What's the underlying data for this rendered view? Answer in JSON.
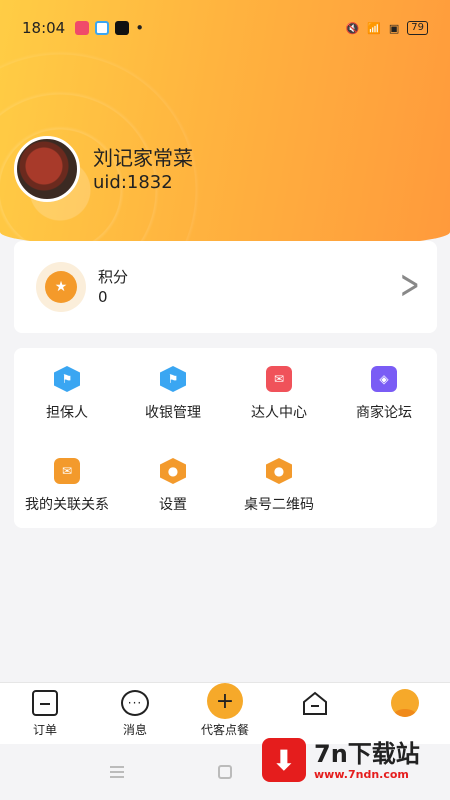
{
  "status_bar": {
    "time": "18:04",
    "battery": "79"
  },
  "profile": {
    "store_name": "刘记家常菜",
    "uid": "uid:1832"
  },
  "points": {
    "label": "积分",
    "value": "0"
  },
  "menu": [
    {
      "label": "担保人",
      "icon": "flag-icon",
      "color": "#3aa6f2"
    },
    {
      "label": "收银管理",
      "icon": "flag-icon",
      "color": "#3aa6f2"
    },
    {
      "label": "达人中心",
      "icon": "envelope-icon",
      "color": "#f0525a"
    },
    {
      "label": "商家论坛",
      "icon": "chat-icon",
      "color": "#7a5cf5"
    },
    {
      "label": "我的关联关系",
      "icon": "mail-icon",
      "color": "#f39a2c"
    },
    {
      "label": "设置",
      "icon": "gear-icon",
      "color": "#f39a2c"
    },
    {
      "label": "桌号二维码",
      "icon": "qrcode-icon",
      "color": "#f39a2c"
    }
  ],
  "bottom_nav": [
    {
      "label": "订单"
    },
    {
      "label": "消息"
    },
    {
      "label": "代客点餐"
    },
    {
      "label": ""
    },
    {
      "label": ""
    }
  ],
  "watermark": {
    "title": "7n下载站",
    "url": "www.7ndn.com"
  }
}
